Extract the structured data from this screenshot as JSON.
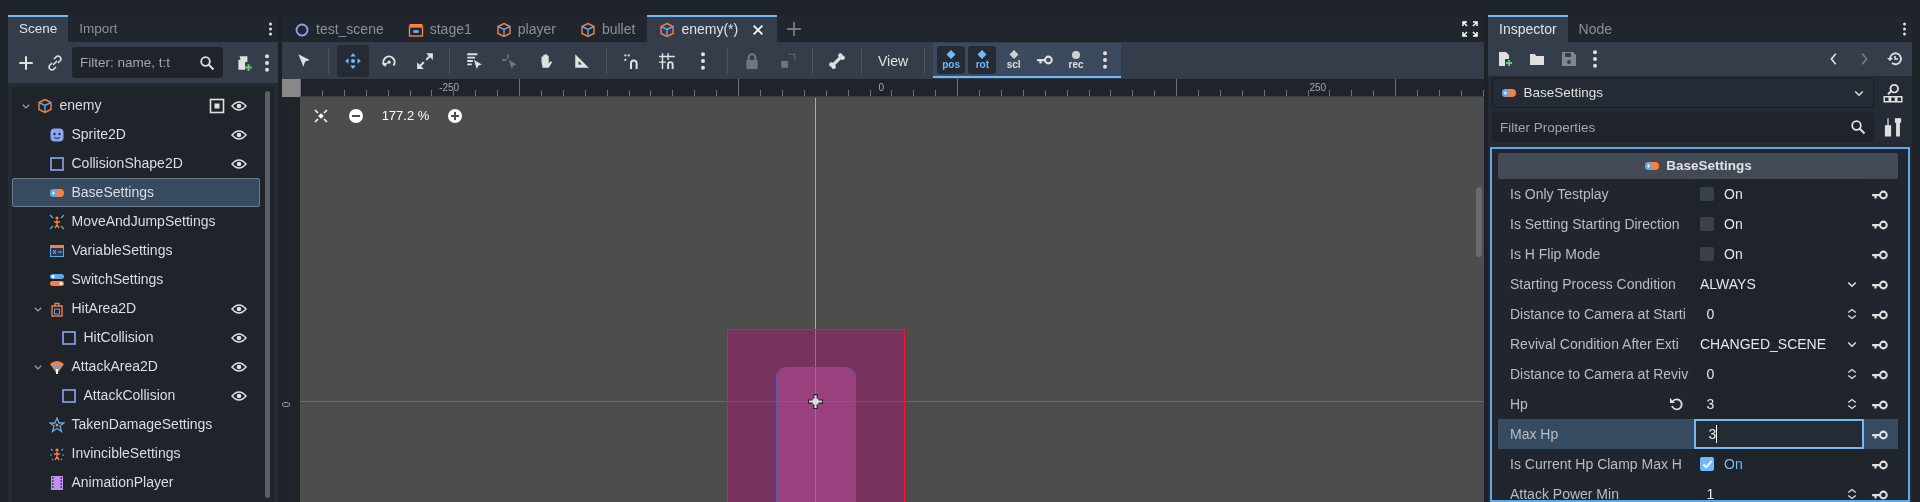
{
  "scene_dock": {
    "tabs": [
      {
        "label": "Scene",
        "selected": true
      },
      {
        "label": "Import",
        "selected": false
      }
    ],
    "filter": {
      "placeholder": "Filter: name, t:t"
    },
    "tree": [
      {
        "label": "enemy",
        "kind": "root",
        "expanded": true,
        "visible": true,
        "selected": false,
        "children": [
          {
            "label": "Sprite2D",
            "kind": "sprite",
            "visible": true,
            "selected": false
          },
          {
            "label": "CollisionShape2D",
            "kind": "collision",
            "visible": true,
            "selected": false
          },
          {
            "label": "BaseSettings",
            "kind": "gamepad",
            "selected": true
          },
          {
            "label": "MoveAndJumpSettings",
            "kind": "move",
            "selected": false
          },
          {
            "label": "VariableSettings",
            "kind": "variable",
            "selected": false
          },
          {
            "label": "SwitchSettings",
            "kind": "switch",
            "selected": false
          },
          {
            "label": "HitArea2D",
            "kind": "area",
            "expanded": true,
            "visible": true,
            "selected": false,
            "children": [
              {
                "label": "HitCollision",
                "kind": "collision",
                "visible": true,
                "selected": false
              }
            ]
          },
          {
            "label": "AttackArea2D",
            "kind": "attack",
            "expanded": true,
            "visible": true,
            "selected": false,
            "children": [
              {
                "label": "AttackCollision",
                "kind": "collision",
                "visible": true,
                "selected": false
              }
            ]
          },
          {
            "label": "TakenDamageSettings",
            "kind": "damage",
            "selected": false
          },
          {
            "label": "InvincibleSettings",
            "kind": "invincible",
            "selected": false
          },
          {
            "label": "AnimationPlayer",
            "kind": "animation",
            "selected": false
          }
        ]
      }
    ]
  },
  "editor": {
    "scene_tabs": [
      {
        "label": "test_scene",
        "kind": "circle",
        "selected": false
      },
      {
        "label": "stage1",
        "kind": "stage",
        "selected": false
      },
      {
        "label": "player",
        "kind": "box",
        "selected": false
      },
      {
        "label": "bullet",
        "kind": "box",
        "selected": false
      },
      {
        "label": "enemy(*)",
        "kind": "box",
        "selected": true
      }
    ],
    "tools": [
      {
        "kind": "select",
        "selected": false,
        "disabled": false
      },
      {
        "kind": "sep"
      },
      {
        "kind": "move",
        "selected": true,
        "disabled": false
      },
      {
        "kind": "rotate",
        "selected": false,
        "disabled": false
      },
      {
        "kind": "scale",
        "selected": false,
        "disabled": false
      },
      {
        "kind": "sep"
      },
      {
        "kind": "list-select",
        "selected": false,
        "disabled": false
      },
      {
        "kind": "pivot",
        "selected": false,
        "disabled": true
      },
      {
        "kind": "pan",
        "selected": false,
        "disabled": false
      },
      {
        "kind": "ruler",
        "selected": false,
        "disabled": false
      },
      {
        "kind": "sep"
      },
      {
        "kind": "snap",
        "selected": false,
        "disabled": false
      },
      {
        "kind": "grid-snap",
        "selected": false,
        "disabled": false
      },
      {
        "kind": "more",
        "selected": false,
        "disabled": false
      },
      {
        "kind": "sep"
      },
      {
        "kind": "lock",
        "selected": false,
        "disabled": true
      },
      {
        "kind": "group",
        "selected": false,
        "disabled": true
      },
      {
        "kind": "sep"
      },
      {
        "kind": "bone",
        "selected": false,
        "disabled": false
      },
      {
        "kind": "sep"
      }
    ],
    "view_menu": "View",
    "key_buttons": [
      {
        "kind": "label",
        "label": "pos",
        "on": true
      },
      {
        "kind": "label",
        "label": "rot",
        "on": true
      },
      {
        "kind": "label",
        "label": "scl",
        "on": false
      },
      {
        "kind": "key"
      },
      {
        "kind": "label",
        "label": "rec",
        "on": false
      },
      {
        "kind": "more"
      }
    ],
    "ruler_labels": [
      "-250",
      "0",
      "250"
    ],
    "side_ruler_label": "0",
    "zoom": "177.2 %"
  },
  "inspector": {
    "tabs": [
      {
        "label": "Inspector",
        "selected": true
      },
      {
        "label": "Node",
        "selected": false
      }
    ],
    "node_selector": "BaseSettings",
    "filter": {
      "placeholder": "Filter Properties"
    },
    "section_title": "BaseSettings",
    "properties": [
      {
        "label": "Is Only Testplay",
        "kind": "check",
        "checked": false,
        "value": "On"
      },
      {
        "label": "Is Setting Starting Direction",
        "kind": "check",
        "checked": false,
        "value": "On"
      },
      {
        "label": "Is H Flip Mode",
        "kind": "check",
        "checked": false,
        "value": "On"
      },
      {
        "label": "Starting Process Condition",
        "kind": "enum",
        "value": "ALWAYS"
      },
      {
        "label": "Distance to Camera at Starti",
        "kind": "number",
        "value": "0"
      },
      {
        "label": "Revival Condition After Exti",
        "kind": "enum",
        "value": "CHANGED_SCENE"
      },
      {
        "label": "Distance to Camera at Reviv",
        "kind": "number",
        "value": "0"
      },
      {
        "label": "Hp",
        "kind": "number",
        "value": "3",
        "revertible": true
      },
      {
        "label": "Max Hp",
        "kind": "edit",
        "value": "3",
        "selected": true
      },
      {
        "label": "Is Current Hp Clamp Max H",
        "kind": "check",
        "checked": true,
        "value": "On"
      },
      {
        "label": "Attack Power Min",
        "kind": "number",
        "value": "1"
      }
    ]
  }
}
